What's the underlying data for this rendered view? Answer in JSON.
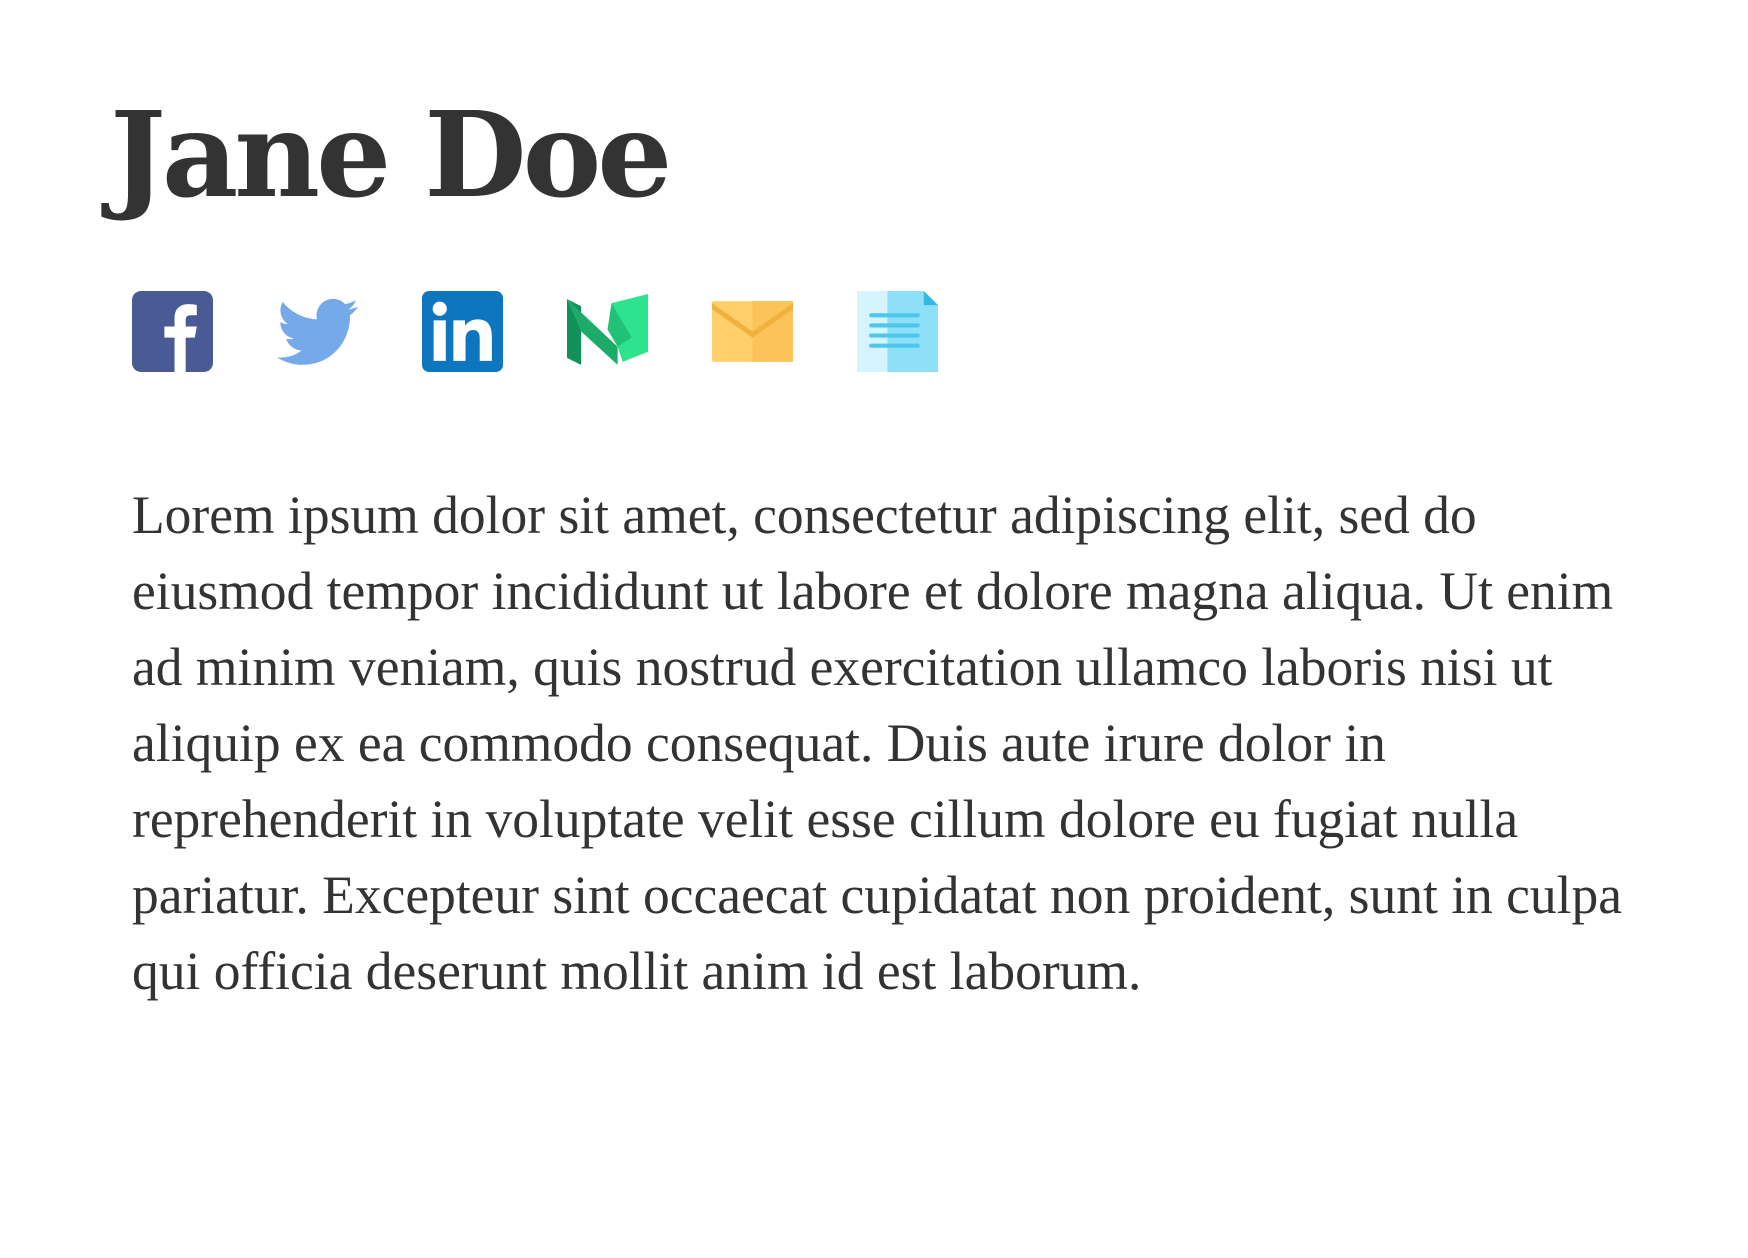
{
  "profile": {
    "name": "Jane Doe",
    "bio": "Lorem ipsum dolor sit amet, consectetur adipiscing elit, sed do eiusmod tempor incididunt ut labore et dolore magna aliqua. Ut enim ad minim veniam, quis nostrud exercitation ullamco laboris nisi ut aliquip ex ea commodo consequat. Duis aute irure dolor in reprehenderit in voluptate velit esse cillum dolore eu fugiat nulla pariatur. Excepteur sint occaecat cupidatat non proident, sunt in culpa qui officia deserunt mollit anim id est laborum."
  },
  "social": {
    "links": [
      {
        "icon": "facebook-icon",
        "color": "#4a5a94"
      },
      {
        "icon": "twitter-icon",
        "color": "#76a9ea"
      },
      {
        "icon": "linkedin-icon",
        "color": "#0e76be"
      },
      {
        "icon": "medium-icon",
        "color": "#20c376"
      },
      {
        "icon": "email-icon",
        "color": "#fcc35b"
      },
      {
        "icon": "document-icon",
        "color": "#8ee0f8"
      }
    ]
  }
}
